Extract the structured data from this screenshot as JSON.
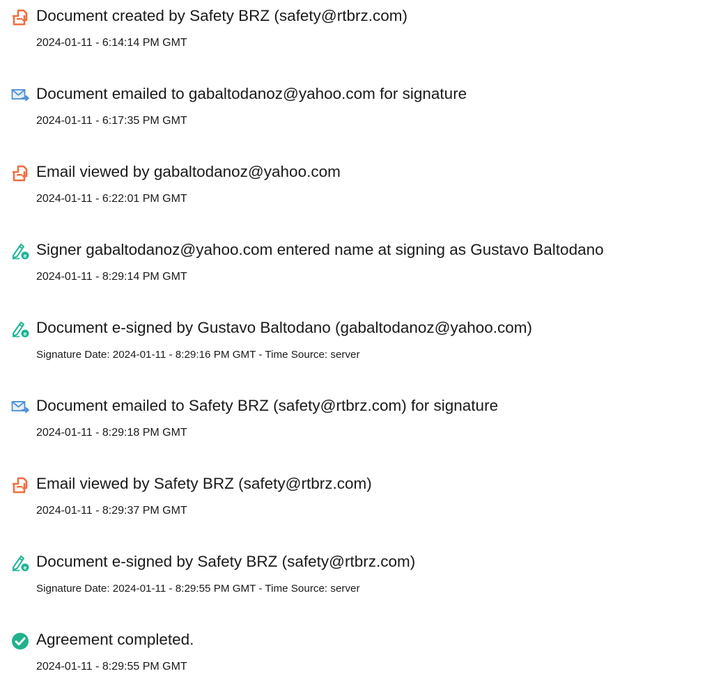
{
  "events": [
    {
      "icon": "document-created-icon",
      "title": "Document created by Safety BRZ (safety@rtbrz.com)",
      "detail": "2024-01-11 - 6:14:14 PM GMT"
    },
    {
      "icon": "email-sent-icon",
      "title": "Document emailed to gabaltodanoz@yahoo.com for signature",
      "detail": "2024-01-11 - 6:17:35 PM GMT"
    },
    {
      "icon": "document-viewed-icon",
      "title": "Email viewed by gabaltodanoz@yahoo.com",
      "detail": "2024-01-11 - 6:22:01 PM GMT"
    },
    {
      "icon": "signature-pen-icon",
      "title": "Signer gabaltodanoz@yahoo.com entered name at signing as Gustavo Baltodano",
      "detail": "2024-01-11 - 8:29:14 PM GMT"
    },
    {
      "icon": "signature-pen-icon",
      "title": "Document e-signed by Gustavo Baltodano (gabaltodanoz@yahoo.com)",
      "detail": "Signature Date: 2024-01-11 - 8:29:16 PM GMT - Time Source: server"
    },
    {
      "icon": "email-sent-icon",
      "title": "Document emailed to Safety BRZ (safety@rtbrz.com) for signature",
      "detail": "2024-01-11 - 8:29:18 PM GMT"
    },
    {
      "icon": "document-viewed-icon",
      "title": "Email viewed by Safety BRZ (safety@rtbrz.com)",
      "detail": "2024-01-11 - 8:29:37 PM GMT"
    },
    {
      "icon": "signature-pen-icon",
      "title": "Document e-signed by Safety BRZ (safety@rtbrz.com)",
      "detail": "Signature Date: 2024-01-11 - 8:29:55 PM GMT - Time Source: server"
    },
    {
      "icon": "checkmark-circle-icon",
      "title": "Agreement completed.",
      "detail": "2024-01-11 - 8:29:55 PM GMT"
    }
  ],
  "colors": {
    "document_icon": "#f26d3d",
    "email_icon": "#4a8fd6",
    "signature_icon": "#1ab394",
    "check_icon": "#20b28c",
    "text": "#1a1a1a"
  }
}
